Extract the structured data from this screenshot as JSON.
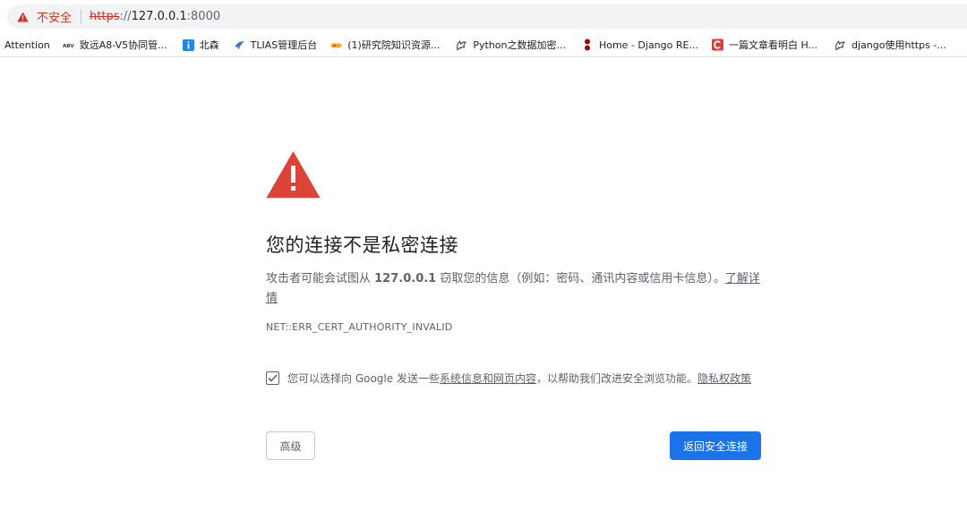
{
  "address_bar": {
    "security_label": "不安全",
    "url_scheme": "https",
    "url_separator": "://",
    "url_host": "127.0.0.1",
    "url_port": ":8000",
    "warning_color": "#d93025"
  },
  "bookmarks": [
    {
      "label": "Attention",
      "icon": "none"
    },
    {
      "label": "致远A8-V5协同管...",
      "icon": "seeyon-logo-icon"
    },
    {
      "label": "北森",
      "icon": "info-icon"
    },
    {
      "label": "TLIAS管理后台",
      "icon": "tlias-logo-icon"
    },
    {
      "label": "(1)研究院知识资源...",
      "icon": "handshake-icon"
    },
    {
      "label": "Python之数据加密...",
      "icon": "wolf-icon"
    },
    {
      "label": "Home - Django RE...",
      "icon": "django-rest-icon"
    },
    {
      "label": "一篇文章看明白 H...",
      "icon": "csdn-icon"
    },
    {
      "label": "django使用https -...",
      "icon": "wolf-icon"
    }
  ],
  "interstitial": {
    "heading": "您的连接不是私密连接",
    "explain_prefix": "攻击者可能会试图从 ",
    "explain_host": "127.0.0.1",
    "explain_suffix": " 窃取您的信息（例如：密码、通讯内容或信用卡信息）。",
    "learn_more": "了解详情",
    "error_code": "NET::ERR_CERT_AUTHORITY_INVALID",
    "optin_prefix": "您可以选择向 Google 发送一些",
    "optin_link": "系统信息和网页内容",
    "optin_middle": "，以帮助我们改进安全浏览功能。",
    "privacy_link": "隐私权政策",
    "optin_checked": true,
    "advanced_button": "高级",
    "back_button": "返回安全连接",
    "accent_color": "#1a73e8",
    "warning_color": "#db4437"
  }
}
